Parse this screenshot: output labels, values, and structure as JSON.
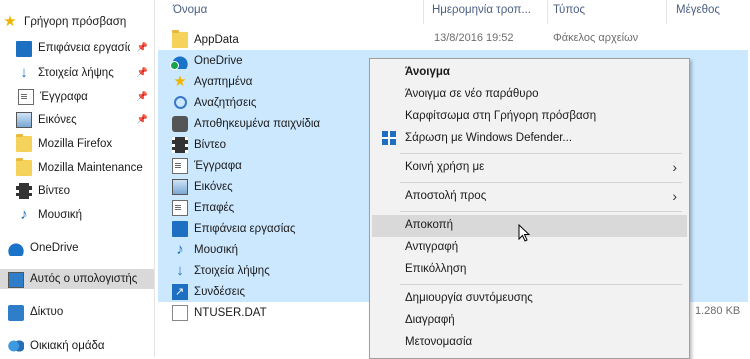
{
  "nav": {
    "items": [
      {
        "label": "Γρήγορη πρόσβαση",
        "icon": "star-icon"
      },
      {
        "label": "Επιφάνεια εργασίας",
        "icon": "desktop-icon",
        "pinned": true
      },
      {
        "label": "Στοιχεία λήψης",
        "icon": "download-icon",
        "pinned": true
      },
      {
        "label": "Έγγραφα",
        "icon": "document-icon",
        "pinned": true
      },
      {
        "label": "Εικόνες",
        "icon": "pictures-icon",
        "pinned": true
      },
      {
        "label": "Mozilla Firefox",
        "icon": "folder-icon"
      },
      {
        "label": "Mozilla Maintenance",
        "icon": "folder-icon"
      },
      {
        "label": "Βίντεο",
        "icon": "video-icon"
      },
      {
        "label": "Μουσική",
        "icon": "music-icon"
      },
      {
        "label": "OneDrive",
        "icon": "onedrive-icon"
      },
      {
        "label": "Αυτός ο υπολογιστής",
        "icon": "computer-icon",
        "selected": true
      },
      {
        "label": "Δίκτυο",
        "icon": "network-icon"
      },
      {
        "label": "Οικιακή ομάδα",
        "icon": "homegroup-icon"
      }
    ]
  },
  "list": {
    "columns": [
      "Όνομα",
      "Ημερομηνία τροπ...",
      "Τύπος",
      "Μέγεθος"
    ],
    "rows": [
      {
        "name": "AppData",
        "date": "13/8/2016 19:52",
        "type": "Φάκελος αρχείων",
        "size": "",
        "icon": "folder-icon",
        "selected": false
      },
      {
        "name": "OneDrive",
        "date": "",
        "type": "",
        "size": "",
        "icon": "onedrive-icon",
        "selected": true
      },
      {
        "name": "Αγαπημένα",
        "date": "",
        "type": "",
        "size": "",
        "icon": "favorites-star-icon",
        "selected": true
      },
      {
        "name": "Αναζητήσεις",
        "date": "",
        "type": "",
        "size": "",
        "icon": "search-icon",
        "selected": true
      },
      {
        "name": "Αποθηκευμένα παιχνίδια",
        "date": "",
        "type": "",
        "size": "",
        "icon": "saved-games-icon",
        "selected": true
      },
      {
        "name": "Βίντεο",
        "date": "",
        "type": "",
        "size": "",
        "icon": "video-icon",
        "selected": true
      },
      {
        "name": "Έγγραφα",
        "date": "",
        "type": "",
        "size": "",
        "icon": "document-icon",
        "selected": true
      },
      {
        "name": "Εικόνες",
        "date": "",
        "type": "",
        "size": "",
        "icon": "pictures-icon",
        "selected": true
      },
      {
        "name": "Επαφές",
        "date": "",
        "type": "",
        "size": "",
        "icon": "contacts-icon",
        "selected": true
      },
      {
        "name": "Επιφάνεια εργασίας",
        "date": "",
        "type": "",
        "size": "",
        "icon": "desktop-icon",
        "selected": true
      },
      {
        "name": "Μουσική",
        "date": "",
        "type": "",
        "size": "",
        "icon": "music-icon",
        "selected": true
      },
      {
        "name": "Στοιχεία λήψης",
        "date": "",
        "type": "",
        "size": "",
        "icon": "download-icon",
        "selected": true
      },
      {
        "name": "Συνδέσεις",
        "date": "",
        "type": "",
        "size": "",
        "icon": "links-icon",
        "selected": true
      },
      {
        "name": "NTUSER.DAT",
        "date": "",
        "type": "",
        "size": "1.280 KB",
        "icon": "file-icon",
        "selected": false
      }
    ]
  },
  "context_menu": {
    "items": [
      {
        "label": "Άνοιγμα",
        "bold": true
      },
      {
        "label": "Άνοιγμα σε νέο παράθυρο"
      },
      {
        "label": "Καρφίτσωμα στη Γρήγορη πρόσβαση"
      },
      {
        "label": "Σάρωση με Windows Defender...",
        "icon": "windows-defender-icon"
      },
      {
        "label": "Κοινή χρήση με",
        "submenu": true
      },
      {
        "label": "Αποστολή προς",
        "submenu": true
      },
      {
        "label": "Αποκοπή",
        "hover": true
      },
      {
        "label": "Αντιγραφή"
      },
      {
        "label": "Επικόλληση"
      },
      {
        "label": "Δημιουργία συντόμευσης"
      },
      {
        "label": "Διαγραφή"
      },
      {
        "label": "Μετονομασία"
      }
    ]
  },
  "colors": {
    "selection": "#cce8ff",
    "menu_hover": "#d9d9d9",
    "header_text": "#4d6082"
  }
}
